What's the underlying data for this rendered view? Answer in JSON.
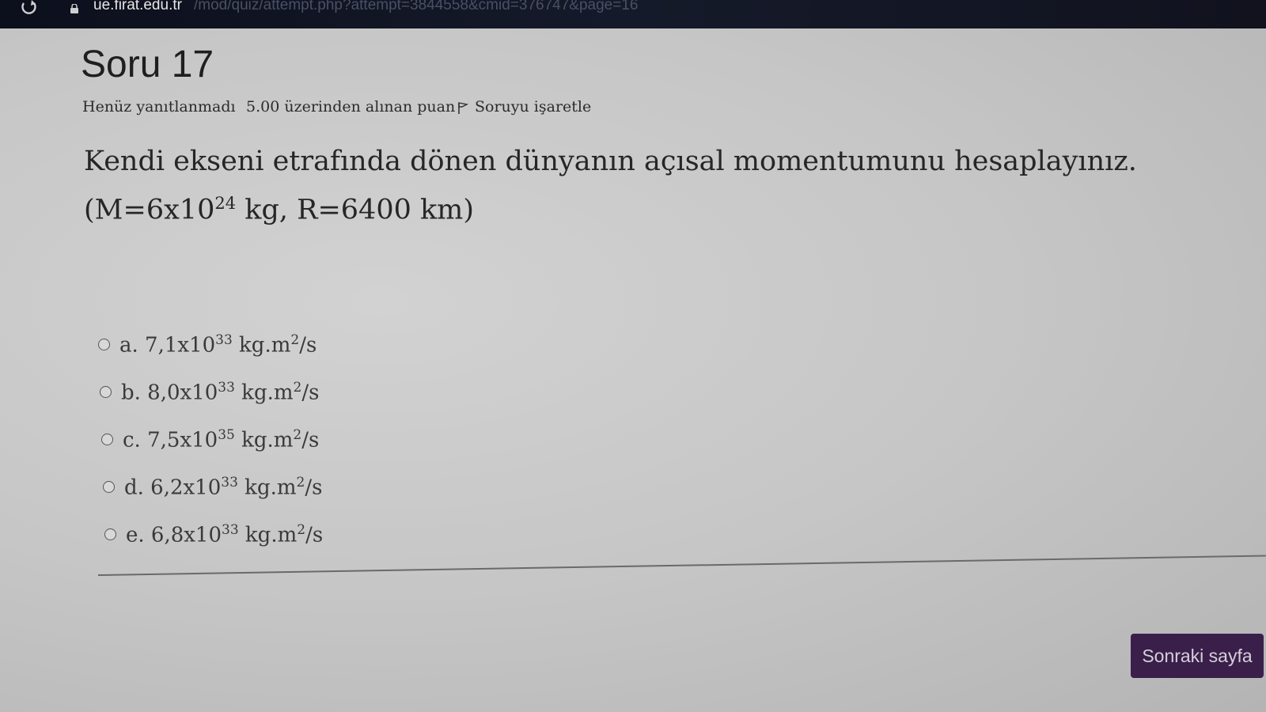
{
  "browser": {
    "url_host": "ue.firat.edu.tr",
    "url_path": "/mod/quiz/attempt.php?attempt=3844558&cmid=376747&page=16"
  },
  "question": {
    "title": "Soru 17",
    "status": "Henüz yanıtlanmadı",
    "points": "5.00 üzerinden alınan puan",
    "flag_label": "Soruyu işaretle",
    "text_part1": "Kendi ekseni etrafında dönen dünyanın açısal momentumunu hesaplayınız. (M=6x10",
    "text_exp": "24",
    "text_part2": " kg, R=6400 km)"
  },
  "answers": [
    {
      "prefix": "a. 7,1x10",
      "exp": "33",
      "unit_base": " kg.m",
      "unit_exp": "2",
      "unit_tail": "/s"
    },
    {
      "prefix": "b. 8,0x10",
      "exp": "33",
      "unit_base": " kg.m",
      "unit_exp": "2",
      "unit_tail": "/s"
    },
    {
      "prefix": "c. 7,5x10",
      "exp": "35",
      "unit_base": " kg.m",
      "unit_exp": "2",
      "unit_tail": "/s"
    },
    {
      "prefix": "d. 6,2x10",
      "exp": "33",
      "unit_base": " kg.m",
      "unit_exp": "2",
      "unit_tail": "/s"
    },
    {
      "prefix": "e. 6,8x10",
      "exp": "33",
      "unit_base": " kg.m",
      "unit_exp": "2",
      "unit_tail": "/s"
    }
  ],
  "navigation": {
    "next_label": "Sonraki sayfa"
  },
  "colors": {
    "accent_button": "#3a1f4a"
  },
  "icons": {
    "reload": "reload-icon",
    "lock": "lock-icon",
    "flag": "flag-icon"
  }
}
